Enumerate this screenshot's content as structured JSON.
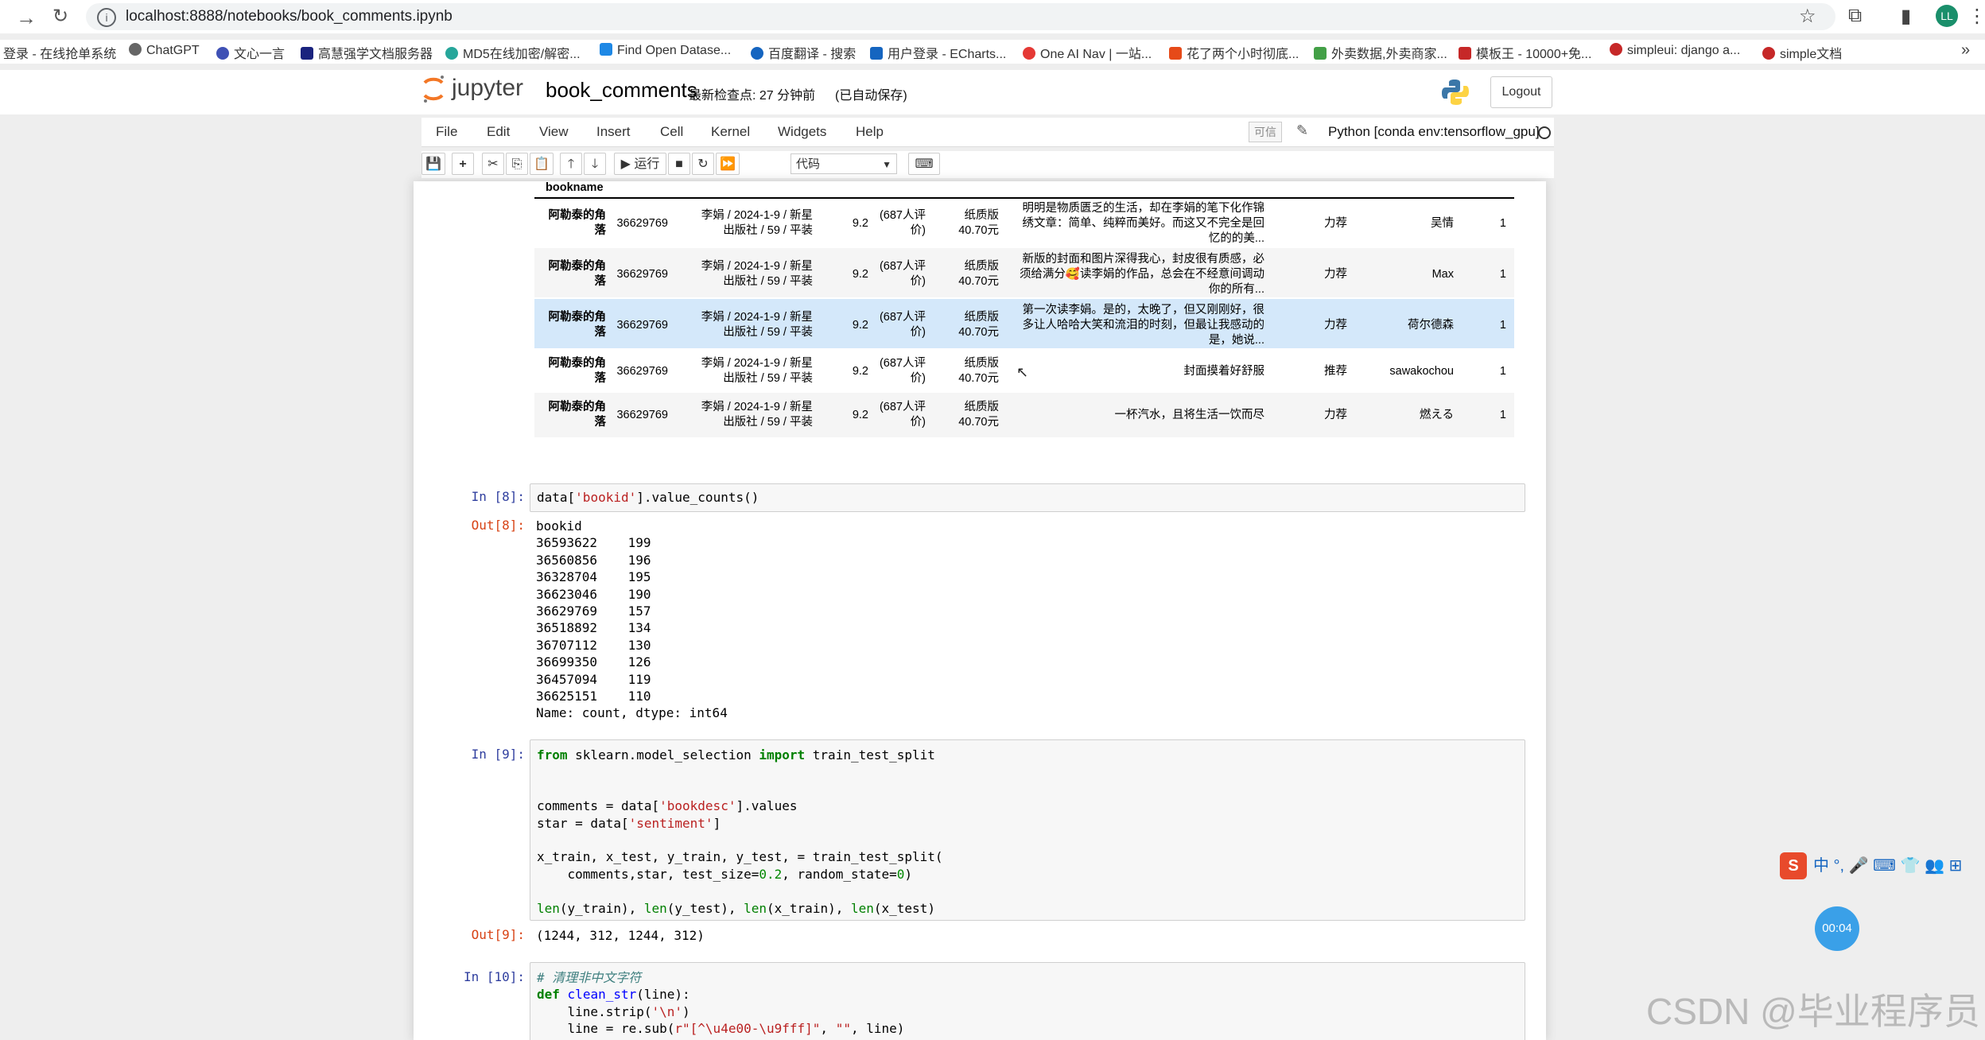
{
  "browser": {
    "url": "localhost:8888/notebooks/book_comments.ipynb",
    "bookmarks": [
      {
        "label": "登录 - 在线抢单系统",
        "color": "#9e9e9e"
      },
      {
        "label": "ChatGPT",
        "color": "#444444"
      },
      {
        "label": "文心一言",
        "color": "#3f51b5"
      },
      {
        "label": "高慧强学文档服务器",
        "color": "#1a237e"
      },
      {
        "label": "MD5在线加密/解密...",
        "color": "#26a69a"
      },
      {
        "label": "Find Open Datase...",
        "color": "#1e88e5"
      },
      {
        "label": "百度翻译 - 搜索",
        "color": "#1565c0"
      },
      {
        "label": "用户登录 - ECharts...",
        "color": "#1565c0"
      },
      {
        "label": "One AI Nav | 一站...",
        "color": "#e53935"
      },
      {
        "label": "花了两个小时彻底...",
        "color": "#e64a19"
      },
      {
        "label": "外卖数据,外卖商家...",
        "color": "#43a047"
      },
      {
        "label": "模板王 - 10000+免...",
        "color": "#c62828"
      },
      {
        "label": "simpleui: django a...",
        "color": "#c62828"
      },
      {
        "label": "simple文档",
        "color": "#c62828"
      }
    ],
    "avatar": "LL"
  },
  "jupyter": {
    "logo_text": "jupyter",
    "notebook_name": "book_comments",
    "checkpoint": "最新检查点: 27 分钟前",
    "autosave": "(已自动保存)",
    "logout": "Logout",
    "menu": [
      "File",
      "Edit",
      "View",
      "Insert",
      "Cell",
      "Kernel",
      "Widgets",
      "Help"
    ],
    "trusted": "可信",
    "kernel": "Python [conda env:tensorflow_gpu]",
    "toolbar": {
      "run": "运行",
      "cell_type": "代码"
    }
  },
  "dataframe": {
    "index_header": "bookname",
    "rows": [
      {
        "bookname": [
          "阿勒泰的角",
          "落"
        ],
        "id": "36629769",
        "pub": [
          "李娟 / 2024-1-9 / 新星",
          "出版社 / 59 / 平装"
        ],
        "score": "9.2",
        "rating": [
          "(687人评",
          "价)"
        ],
        "price": [
          "纸质版",
          "40.70元"
        ],
        "desc": [
          "明明是物质匮乏的生活，却在李娟的笔下化作锦",
          "绣文章：简单、纯粹而美好。而这又不完全是回",
          "忆的的美..."
        ],
        "rec": "力荐",
        "user": "吴情",
        "sent": "1"
      },
      {
        "bookname": [
          "阿勒泰的角",
          "落"
        ],
        "id": "36629769",
        "pub": [
          "李娟 / 2024-1-9 / 新星",
          "出版社 / 59 / 平装"
        ],
        "score": "9.2",
        "rating": [
          "(687人评",
          "价)"
        ],
        "price": [
          "纸质版",
          "40.70元"
        ],
        "desc": [
          "新版的封面和图片深得我心，封皮很有质感，必",
          "须给满分🥰读李娟的作品，总会在不经意间调动",
          "你的所有..."
        ],
        "rec": "力荐",
        "user": "Max",
        "sent": "1"
      },
      {
        "bookname": [
          "阿勒泰的角",
          "落"
        ],
        "id": "36629769",
        "pub": [
          "李娟 / 2024-1-9 / 新星",
          "出版社 / 59 / 平装"
        ],
        "score": "9.2",
        "rating": [
          "(687人评",
          "价)"
        ],
        "price": [
          "纸质版",
          "40.70元"
        ],
        "desc": [
          "第一次读李娟。是的，太晚了，但又刚刚好，很",
          "多让人哈哈大笑和流泪的时刻，但最让我感动的",
          "是，她说..."
        ],
        "rec": "力荐",
        "user": "荷尔德森",
        "sent": "1"
      },
      {
        "bookname": [
          "阿勒泰的角",
          "落"
        ],
        "id": "36629769",
        "pub": [
          "李娟 / 2024-1-9 / 新星",
          "出版社 / 59 / 平装"
        ],
        "score": "9.2",
        "rating": [
          "(687人评",
          "价)"
        ],
        "price": [
          "纸质版",
          "40.70元"
        ],
        "desc": [
          "封面摸着好舒服"
        ],
        "rec": "推荐",
        "user": "sawakochou",
        "sent": "1"
      },
      {
        "bookname": [
          "阿勒泰的角",
          "落"
        ],
        "id": "36629769",
        "pub": [
          "李娟 / 2024-1-9 / 新星",
          "出版社 / 59 / 平装"
        ],
        "score": "9.2",
        "rating": [
          "(687人评",
          "价)"
        ],
        "price": [
          "纸质版",
          "40.70元"
        ],
        "desc": [
          "一杯汽水，且将生活一饮而尽"
        ],
        "rec": "力荐",
        "user": "燃える",
        "sent": "1"
      }
    ]
  },
  "cells": {
    "in8": {
      "prompt": "In  [8]:",
      "code": "data['bookid'].value_counts()",
      "out_prompt": "Out[8]:",
      "output": "bookid\n36593622    199\n36560856    196\n36328704    195\n36623046    190\n36629769    157\n36518892    134\n36707112    130\n36699350    126\n36457094    119\n36625151    110\nName: count, dtype: int64"
    },
    "in9": {
      "prompt": "In  [9]:",
      "out_prompt": "Out[9]:",
      "output": "(1244, 312, 1244, 312)"
    },
    "in10": {
      "prompt": "In  [10]:"
    }
  },
  "overlays": {
    "timer": "00:04",
    "watermark": "CSDN @毕业程序员",
    "ime": "中 °, 🎤 ⌨ 👕 👥 ⊞"
  }
}
